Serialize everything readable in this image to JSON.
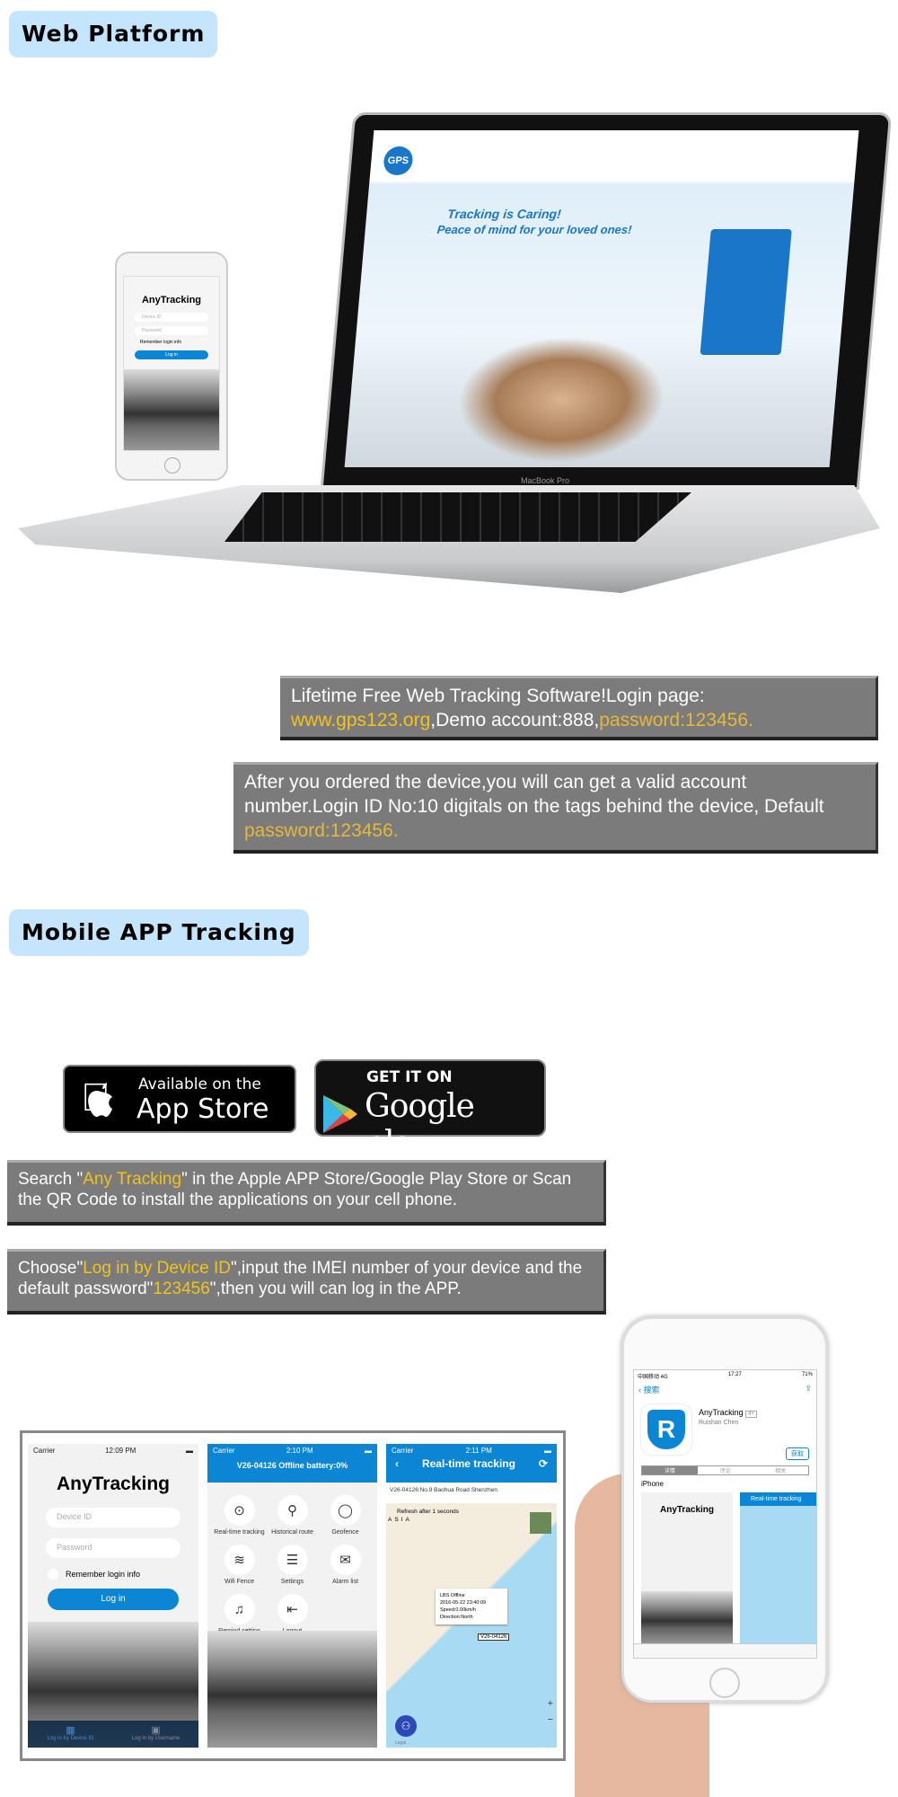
{
  "section1": {
    "title": "Web Platform"
  },
  "laptop": {
    "site_logo": "GPS",
    "slogan_line1": "Tracking is Caring!",
    "slogan_line2": "Peace of mind for your loved ones!",
    "brand": "MacBook Pro"
  },
  "small_phone": {
    "app_title": "AnyTracking",
    "field1": "Device ID",
    "field2": "Password",
    "remember": "Remember login info",
    "login": "Log in"
  },
  "info1": {
    "text_a": "Lifetime Free Web Tracking Software!Login page:",
    "url": "www.gps123.org",
    "text_b": ",Demo account:888,",
    "password": "password:123456."
  },
  "info2": {
    "text_a": "After you ordered the device,you will can get a valid account number.Login ID No:10 digitals on the tags behind the device, Default ",
    "password": "password:123456."
  },
  "section2": {
    "title": "Mobile APP Tracking"
  },
  "appstore": {
    "small": "Available on the",
    "big": "App Store",
    "icon": "apple-logo-icon"
  },
  "googleplay": {
    "small": "GET IT ON",
    "big": "Google play",
    "icon": "google-play-icon"
  },
  "info3": {
    "a": "Search \"",
    "hl": "Any Tracking",
    "b": "\" in the Apple APP Store/Google Play Store or Scan the QR Code to install the applications on your cell phone."
  },
  "info4": {
    "a": "Choose\"",
    "hl1": "Log in by Device ID",
    "b": "\",input the IMEI number of your device and the default password\"",
    "hl2": "123456",
    "c": "\",then you will can log in the APP."
  },
  "screen1": {
    "carrier": "Carrier",
    "time": "12:09 PM",
    "title": "AnyTracking",
    "device_id": "Device ID",
    "password": "Password",
    "remember": "Remember login info",
    "login": "Log in",
    "tab1": "Log in by Device ID",
    "tab2": "Log in by Username"
  },
  "screen2": {
    "carrier": "Carrier",
    "time": "2:10 PM",
    "header": "V26-04126 Offline battery:0%",
    "items": [
      {
        "label": "Real-time tracking",
        "icon": "crosshair-icon"
      },
      {
        "label": "Historical route",
        "icon": "location-pin-icon"
      },
      {
        "label": "Geofence",
        "icon": "circle-icon"
      },
      {
        "label": "Wifi Fence",
        "icon": "wifi-icon"
      },
      {
        "label": "Settings",
        "icon": "sliders-icon"
      },
      {
        "label": "Alarm list",
        "icon": "envelope-icon"
      },
      {
        "label": "Remind setting",
        "icon": "bell-icon"
      },
      {
        "label": "Logout",
        "icon": "logout-icon"
      }
    ]
  },
  "screen3": {
    "carrier": "Carrier",
    "time": "2:11 PM",
    "title": "Real-time tracking",
    "address": "V26-04126:No.9 Baohua Road Shenzhen",
    "refresh": "Refresh after 1 seconds",
    "region": "ASIA",
    "popup": [
      "LBS Offline",
      "2016-05-22 23:40:09",
      "Speed:0.00km/h",
      "Direction:North"
    ],
    "marker": "V26-04126",
    "legal": "Legal"
  },
  "hand_phone": {
    "status_left": "中国移动 4G",
    "time": "17:27",
    "battery": "71%",
    "back": "搜索",
    "app_name": "AnyTracking",
    "age": "4+",
    "developer": "Ruishan Chen",
    "get": "获取",
    "tabs": [
      "详情",
      "评论",
      "相关"
    ],
    "platform": "iPhone",
    "mini_title": "AnyTracking",
    "mini_header": "Real-time tracking"
  },
  "colors": {
    "badge": "#c4e5fb",
    "box": "#7b7b7b",
    "highlight": "#f2c31a",
    "app_blue": "#0a86d4"
  }
}
